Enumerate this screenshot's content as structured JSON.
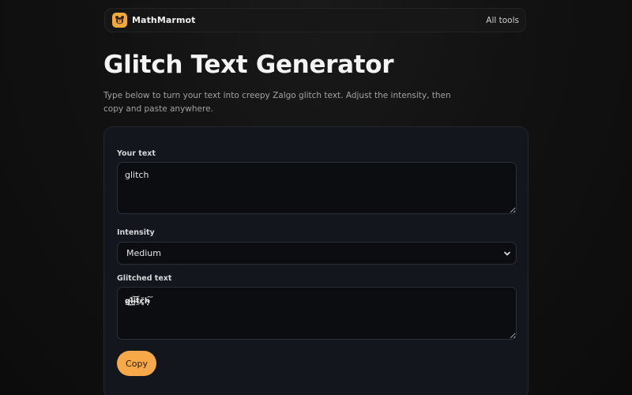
{
  "header": {
    "brand": "MathMarmot",
    "nav_link": "All tools",
    "logo_icon": "marmot-icon"
  },
  "main": {
    "title": "Glitch Text Generator",
    "subtitle": "Type below to turn your text into creepy Zalgo glitch text. Adjust the intensity, then copy and paste anywhere."
  },
  "form": {
    "input_label": "Your text",
    "input_value": "glitch",
    "intensity_label": "Intensity",
    "intensity_value": "Medium",
    "output_label": "Glitched text",
    "output_value": "g̷̙͜l̴̰̎i̵̪͝t̶̤̄c̷̻̆h̴̘͠",
    "copy_label": "Copy"
  },
  "colors": {
    "accent": "#f7a94a",
    "background": "#121212",
    "card": "#13161c"
  }
}
